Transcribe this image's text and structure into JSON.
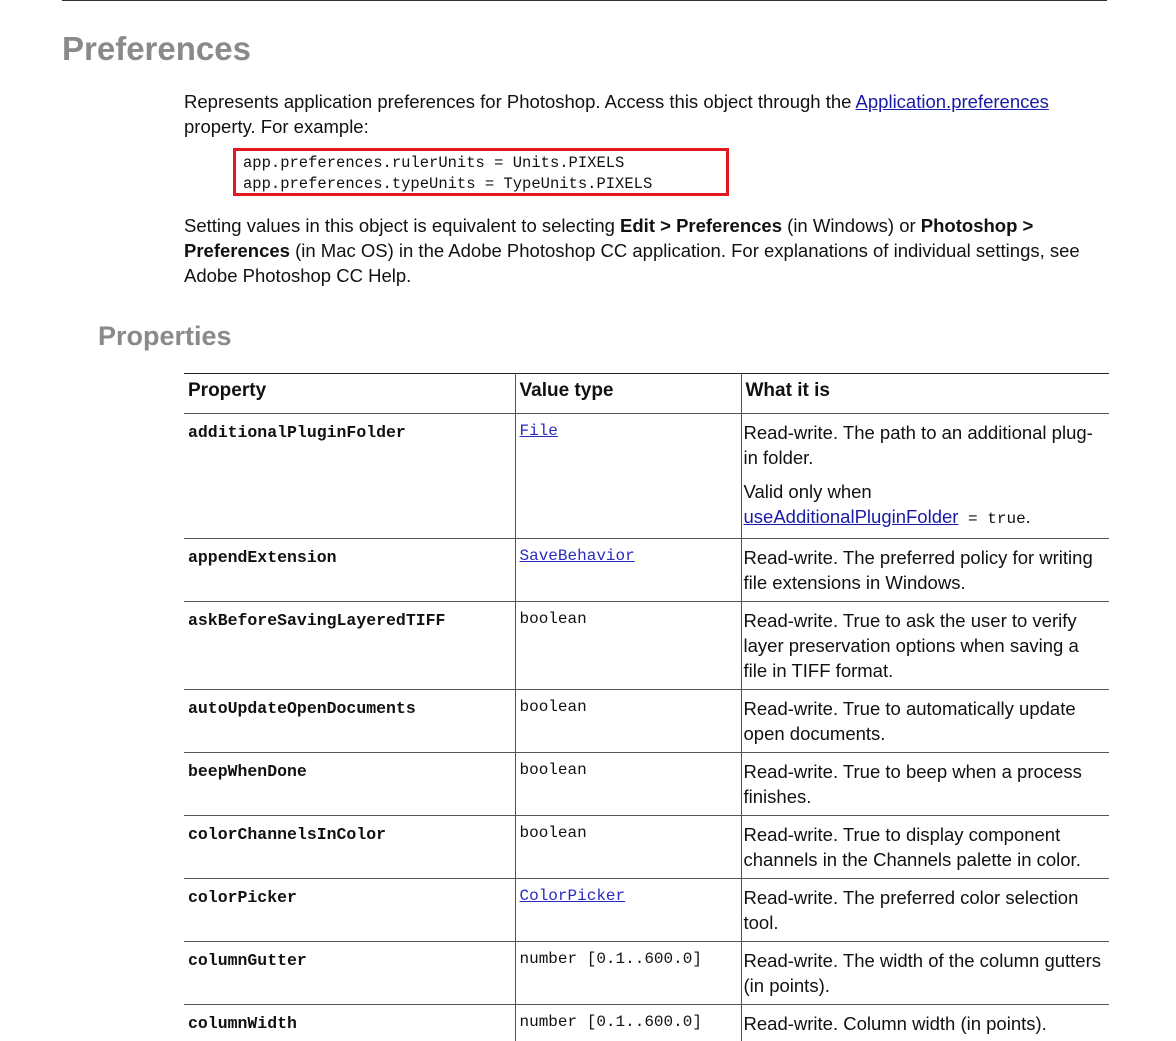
{
  "page": {
    "title": "Preferences",
    "intro": {
      "text_before": "Represents application preferences for Photoshop. Access this object through the ",
      "link_application": "Application",
      "link_preferences": ".preferences",
      "text_after": "property. For example:"
    },
    "code": [
      "app.preferences.rulerUnits = Units.PIXELS",
      "app.preferences.typeUnits = TypeUnits.PIXELS"
    ],
    "setting": {
      "t1": "Setting values in this object is equivalent to selecting ",
      "b1": "Edit > Preferences",
      "t2": " (in Windows) or ",
      "b2": "Photoshop > Preferences",
      "t3": " (in Mac OS) in the Adobe Photoshop CC application. For explanations of individual settings, see Adobe Photoshop CC Help."
    },
    "section_title": "Properties",
    "highlight_color": "#e3171f",
    "link_color": "#1a1aa8"
  },
  "table": {
    "headers": [
      "Property",
      "Value type",
      "What it is"
    ],
    "rows": [
      {
        "property": "additionalPluginFolder",
        "value_type": "File",
        "value_type_link": true,
        "desc": "Read-write. The path to an additional plug-in folder.",
        "note_before": "Valid only when ",
        "note_link": "useAdditionalPluginFolder",
        "note_code": " = true",
        "note_after": "."
      },
      {
        "property": "appendExtension",
        "value_type": "SaveBehavior",
        "value_type_link": true,
        "desc": "Read-write. The preferred policy for writing file extensions in Windows."
      },
      {
        "property": "askBeforeSavingLayeredTIFF",
        "value_type": "boolean",
        "value_type_link": false,
        "desc": "Read-write. True to ask the user to verify layer preservation options when saving a file in TIFF format."
      },
      {
        "property": "autoUpdateOpenDocuments",
        "value_type": "boolean",
        "value_type_link": false,
        "desc": "Read-write. True to automatically update open documents."
      },
      {
        "property": "beepWhenDone",
        "value_type": "boolean",
        "value_type_link": false,
        "desc": "Read-write. True to beep when a process finishes."
      },
      {
        "property": "colorChannelsInColor",
        "value_type": "boolean",
        "value_type_link": false,
        "desc": "Read-write. True to display component channels in the Channels palette in color."
      },
      {
        "property": "colorPicker",
        "value_type": "ColorPicker",
        "value_type_link": true,
        "desc": "Read-write. The preferred color selection tool."
      },
      {
        "property": "columnGutter",
        "value_type": "number [0.1..600.0]",
        "value_type_link": false,
        "desc": "Read-write. The width of the column gutters (in points)."
      },
      {
        "property": "columnWidth",
        "value_type": "number [0.1..600.0]",
        "value_type_link": false,
        "desc": "Read-write. Column width (in points)."
      }
    ]
  }
}
